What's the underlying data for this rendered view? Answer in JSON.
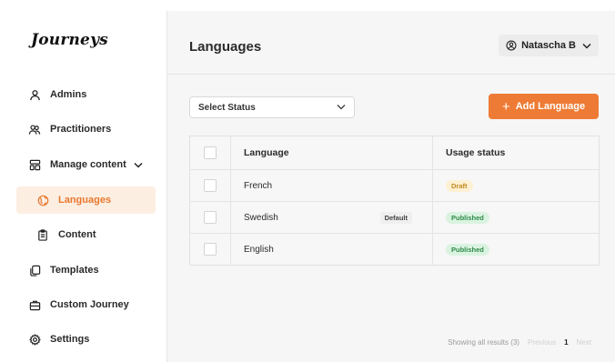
{
  "app": {
    "logo": "Journeys"
  },
  "sidebar": {
    "items": [
      {
        "label": "Admins"
      },
      {
        "label": "Practitioners"
      },
      {
        "label": "Manage content"
      },
      {
        "label": "Languages"
      },
      {
        "label": "Content"
      },
      {
        "label": "Templates"
      },
      {
        "label": "Custom Journey"
      },
      {
        "label": "Settings"
      }
    ]
  },
  "header": {
    "title": "Languages",
    "user_name": "Natascha B"
  },
  "toolbar": {
    "status_select": "Select Status",
    "add_label": "Add Language"
  },
  "table": {
    "columns": [
      "Language",
      "Usage status"
    ],
    "rows": [
      {
        "language": "French",
        "tag": "",
        "status": "Draft"
      },
      {
        "language": "Swedish",
        "tag": "Default",
        "status": "Published"
      },
      {
        "language": "English",
        "tag": "",
        "status": "Published"
      }
    ]
  },
  "pagination": {
    "summary": "Showing all results (3)",
    "previous": "Previous",
    "page": "1",
    "next": "Next"
  },
  "colors": {
    "accent": "#ee7b35",
    "active_bg": "#fdeee2",
    "draft_bg": "#fdf0d3",
    "published_bg": "#daf3e0"
  }
}
